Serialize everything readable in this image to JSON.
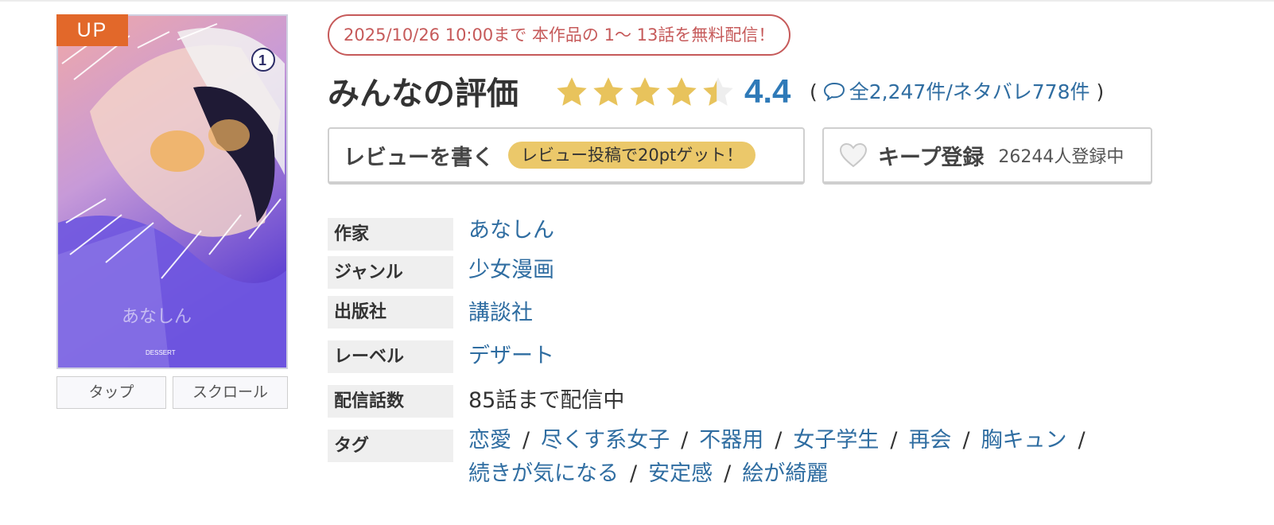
{
  "badge": "UP",
  "cover_buttons": {
    "tap": "タップ",
    "scroll": "スクロール"
  },
  "campaign": "2025/10/26 10:00まで 本作品の 1〜 13話を無料配信！",
  "rating": {
    "title": "みんなの評価",
    "score": "4.4",
    "stars_value": 4.4,
    "stars_max": 5,
    "open_paren": "(",
    "total": "全2,247件",
    "slash": "/",
    "spoiler": "ネタバレ778件",
    "close_paren": ")"
  },
  "review": {
    "label": "レビューを書く",
    "promo": "レビュー投稿で20ptゲット！"
  },
  "keep": {
    "label": "キープ登録",
    "count": "26244人登録中"
  },
  "info": {
    "author": {
      "label": "作家",
      "value": "あなしん"
    },
    "genre": {
      "label": "ジャンル",
      "value": "少女漫画"
    },
    "publisher": {
      "label": "出版社",
      "value": "講談社"
    },
    "imprint": {
      "label": "レーベル",
      "value": "デザート"
    },
    "episodes": {
      "label": "配信話数",
      "value": "85話まで配信中"
    },
    "tags": {
      "label": "タグ",
      "items": [
        "恋愛",
        "尽くす系女子",
        "不器用",
        "女子学生",
        "再会",
        "胸キュン",
        "続きが気になる",
        "安定感",
        "絵が綺麗"
      ]
    }
  },
  "colors": {
    "accent_blue": "#2f7ab8",
    "link": "#2f6da1",
    "campaign_red": "#c65a5a",
    "star": "#e8c35c",
    "badge": "#e2682a",
    "promo": "#ebc86a"
  },
  "icons": {
    "stars": "star-icon",
    "comment": "speech-bubble-icon",
    "keep": "heart-icon"
  }
}
